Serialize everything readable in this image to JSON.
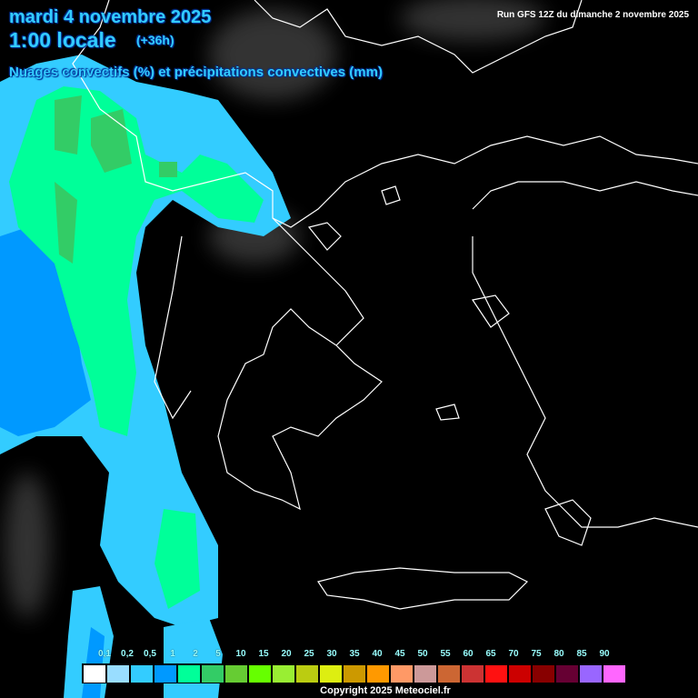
{
  "header": {
    "date": "mardi 4 novembre 2025",
    "time": "1:00 locale",
    "lead_time": "(+36h)",
    "subtitle": "Nuages convectifs (%) et précipitations convectives (mm)",
    "run": "Run GFS 12Z du dimanche 2 novembre 2025"
  },
  "legend": {
    "labels": [
      "0,1",
      "0,2",
      "0,5",
      "1",
      "2",
      "5",
      "10",
      "15",
      "20",
      "25",
      "30",
      "35",
      "40",
      "45",
      "50",
      "55",
      "60",
      "65",
      "70",
      "75",
      "80",
      "85",
      "90"
    ],
    "colors": [
      "#ffffff",
      "#99ddff",
      "#33ccff",
      "#0099ff",
      "#00ff99",
      "#33cc66",
      "#66cc33",
      "#66ff00",
      "#99ee33",
      "#bbcc11",
      "#ddee11",
      "#cc9900",
      "#ff9900",
      "#ff9966",
      "#cc9999",
      "#cc6633",
      "#cc3333",
      "#ff1111",
      "#cc0000",
      "#880000",
      "#660033",
      "#9966ff",
      "#ff66ff"
    ]
  },
  "footer": {
    "copyright": "Copyright 2025 Meteociel.fr"
  }
}
